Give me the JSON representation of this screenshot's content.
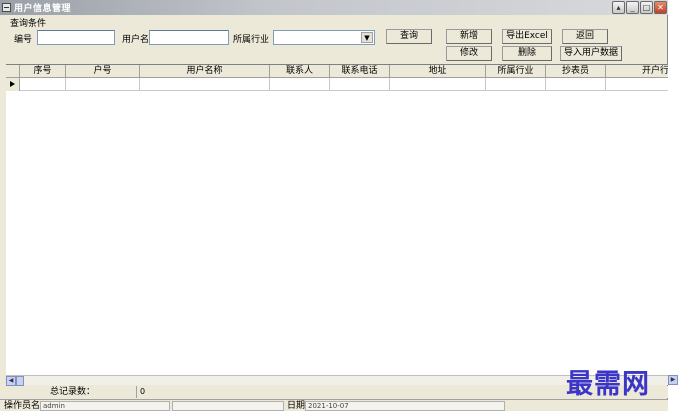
{
  "window": {
    "title": "用户信息管理"
  },
  "query": {
    "group_label": "查询条件",
    "code_label": "编号",
    "code_value": "",
    "username_label": "用户名",
    "username_value": "",
    "industry_label": "所属行业",
    "industry_value": ""
  },
  "toolbar": {
    "search": "查询",
    "add": "新增",
    "edit": "修改",
    "export": "导出Excel",
    "delete": "删除",
    "back": "返回",
    "import": "导入用户数据"
  },
  "grid": {
    "columns": [
      "序号",
      "户号",
      "用户名称",
      "联系人",
      "联系电话",
      "地址",
      "所属行业",
      "抄表员",
      "开户行"
    ]
  },
  "summary": {
    "total_label": "总记录数：",
    "total_value": "0"
  },
  "status": {
    "operator_label": "操作员名",
    "operator_value": "admin",
    "date_label": "日期",
    "date_value": "2021-10-07"
  },
  "watermark": {
    "text": "最需网"
  },
  "colors": {
    "watermark": "#3b36c8",
    "window_bg": "#ece9d8"
  }
}
